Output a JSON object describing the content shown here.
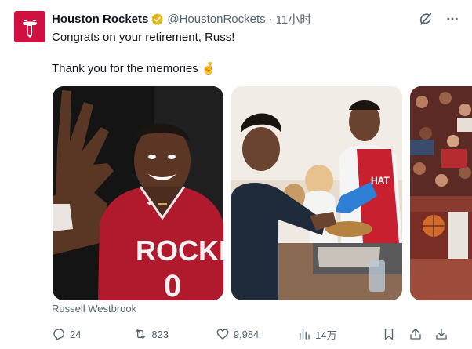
{
  "tweet": {
    "author_name": "Houston Rockets",
    "handle": "@HoustonRockets",
    "separator": "·",
    "time": "11小时",
    "line1": "Congrats on your retirement, Russ!",
    "line2": "Thank you for the memories 🤞",
    "jersey_text": "ROCKETS",
    "jersey_number": "0",
    "apron_text": "HAT",
    "media_caption": "Russell Westbrook"
  },
  "metrics": {
    "replies": "24",
    "reposts": "823",
    "likes": "9,984",
    "views": "14万"
  },
  "colors": {
    "brand_red": "#ce1141",
    "verified_gold": "#e2b719",
    "meta_gray": "#536471"
  },
  "icons": [
    "rockets-logo-icon",
    "verified-badge-icon",
    "grok-icon",
    "more-icon",
    "reply-icon",
    "repost-icon",
    "like-icon",
    "views-icon",
    "bookmark-icon",
    "share-icon",
    "download-icon"
  ]
}
